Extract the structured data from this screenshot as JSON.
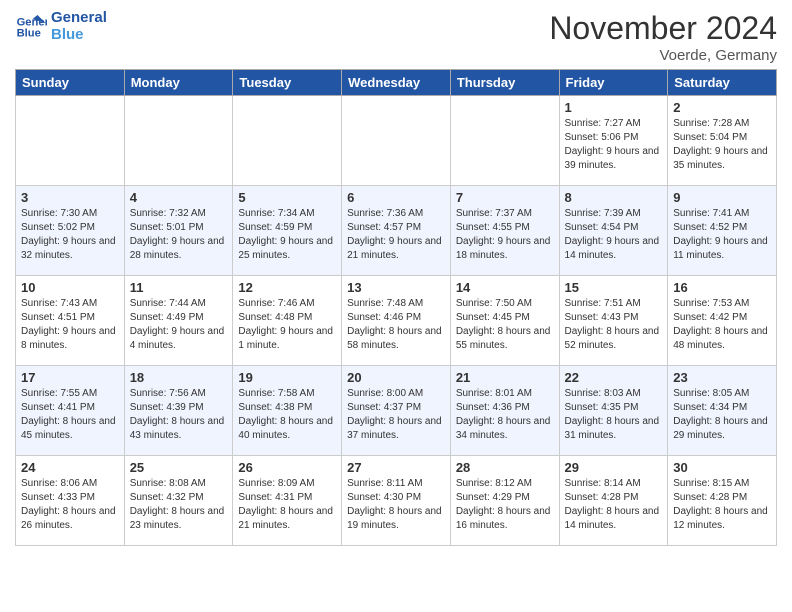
{
  "logo": {
    "line1": "General",
    "line2": "Blue"
  },
  "title": "November 2024",
  "location": "Voerde, Germany",
  "weekdays": [
    "Sunday",
    "Monday",
    "Tuesday",
    "Wednesday",
    "Thursday",
    "Friday",
    "Saturday"
  ],
  "weeks": [
    [
      {
        "day": "",
        "info": ""
      },
      {
        "day": "",
        "info": ""
      },
      {
        "day": "",
        "info": ""
      },
      {
        "day": "",
        "info": ""
      },
      {
        "day": "",
        "info": ""
      },
      {
        "day": "1",
        "info": "Sunrise: 7:27 AM\nSunset: 5:06 PM\nDaylight: 9 hours and 39 minutes."
      },
      {
        "day": "2",
        "info": "Sunrise: 7:28 AM\nSunset: 5:04 PM\nDaylight: 9 hours and 35 minutes."
      }
    ],
    [
      {
        "day": "3",
        "info": "Sunrise: 7:30 AM\nSunset: 5:02 PM\nDaylight: 9 hours and 32 minutes."
      },
      {
        "day": "4",
        "info": "Sunrise: 7:32 AM\nSunset: 5:01 PM\nDaylight: 9 hours and 28 minutes."
      },
      {
        "day": "5",
        "info": "Sunrise: 7:34 AM\nSunset: 4:59 PM\nDaylight: 9 hours and 25 minutes."
      },
      {
        "day": "6",
        "info": "Sunrise: 7:36 AM\nSunset: 4:57 PM\nDaylight: 9 hours and 21 minutes."
      },
      {
        "day": "7",
        "info": "Sunrise: 7:37 AM\nSunset: 4:55 PM\nDaylight: 9 hours and 18 minutes."
      },
      {
        "day": "8",
        "info": "Sunrise: 7:39 AM\nSunset: 4:54 PM\nDaylight: 9 hours and 14 minutes."
      },
      {
        "day": "9",
        "info": "Sunrise: 7:41 AM\nSunset: 4:52 PM\nDaylight: 9 hours and 11 minutes."
      }
    ],
    [
      {
        "day": "10",
        "info": "Sunrise: 7:43 AM\nSunset: 4:51 PM\nDaylight: 9 hours and 8 minutes."
      },
      {
        "day": "11",
        "info": "Sunrise: 7:44 AM\nSunset: 4:49 PM\nDaylight: 9 hours and 4 minutes."
      },
      {
        "day": "12",
        "info": "Sunrise: 7:46 AM\nSunset: 4:48 PM\nDaylight: 9 hours and 1 minute."
      },
      {
        "day": "13",
        "info": "Sunrise: 7:48 AM\nSunset: 4:46 PM\nDaylight: 8 hours and 58 minutes."
      },
      {
        "day": "14",
        "info": "Sunrise: 7:50 AM\nSunset: 4:45 PM\nDaylight: 8 hours and 55 minutes."
      },
      {
        "day": "15",
        "info": "Sunrise: 7:51 AM\nSunset: 4:43 PM\nDaylight: 8 hours and 52 minutes."
      },
      {
        "day": "16",
        "info": "Sunrise: 7:53 AM\nSunset: 4:42 PM\nDaylight: 8 hours and 48 minutes."
      }
    ],
    [
      {
        "day": "17",
        "info": "Sunrise: 7:55 AM\nSunset: 4:41 PM\nDaylight: 8 hours and 45 minutes."
      },
      {
        "day": "18",
        "info": "Sunrise: 7:56 AM\nSunset: 4:39 PM\nDaylight: 8 hours and 43 minutes."
      },
      {
        "day": "19",
        "info": "Sunrise: 7:58 AM\nSunset: 4:38 PM\nDaylight: 8 hours and 40 minutes."
      },
      {
        "day": "20",
        "info": "Sunrise: 8:00 AM\nSunset: 4:37 PM\nDaylight: 8 hours and 37 minutes."
      },
      {
        "day": "21",
        "info": "Sunrise: 8:01 AM\nSunset: 4:36 PM\nDaylight: 8 hours and 34 minutes."
      },
      {
        "day": "22",
        "info": "Sunrise: 8:03 AM\nSunset: 4:35 PM\nDaylight: 8 hours and 31 minutes."
      },
      {
        "day": "23",
        "info": "Sunrise: 8:05 AM\nSunset: 4:34 PM\nDaylight: 8 hours and 29 minutes."
      }
    ],
    [
      {
        "day": "24",
        "info": "Sunrise: 8:06 AM\nSunset: 4:33 PM\nDaylight: 8 hours and 26 minutes."
      },
      {
        "day": "25",
        "info": "Sunrise: 8:08 AM\nSunset: 4:32 PM\nDaylight: 8 hours and 23 minutes."
      },
      {
        "day": "26",
        "info": "Sunrise: 8:09 AM\nSunset: 4:31 PM\nDaylight: 8 hours and 21 minutes."
      },
      {
        "day": "27",
        "info": "Sunrise: 8:11 AM\nSunset: 4:30 PM\nDaylight: 8 hours and 19 minutes."
      },
      {
        "day": "28",
        "info": "Sunrise: 8:12 AM\nSunset: 4:29 PM\nDaylight: 8 hours and 16 minutes."
      },
      {
        "day": "29",
        "info": "Sunrise: 8:14 AM\nSunset: 4:28 PM\nDaylight: 8 hours and 14 minutes."
      },
      {
        "day": "30",
        "info": "Sunrise: 8:15 AM\nSunset: 4:28 PM\nDaylight: 8 hours and 12 minutes."
      }
    ]
  ]
}
